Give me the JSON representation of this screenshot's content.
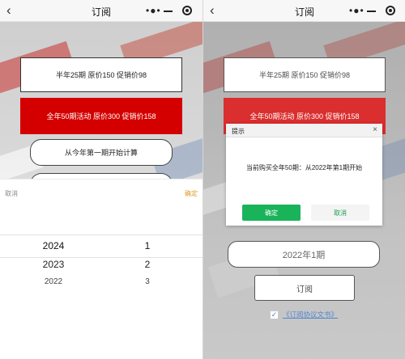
{
  "colors": {
    "accent_red": "#d40000",
    "confirm_orange": "#e59a2b",
    "ok_green": "#19b35a",
    "link_blue": "#2a6bc2"
  },
  "left_screen": {
    "navbar": {
      "back_icon": "chevron-left-icon",
      "title": "订阅",
      "more_icon": "more-dots-icon",
      "minimize_icon": "minimize-icon",
      "close_icon": "target-close-icon"
    },
    "plans": {
      "half_year": "半年25期 原价150 促销价98",
      "full_year": "全年50期活动 原价300 促销价158"
    },
    "start_button": "从今年第一期开始计算",
    "picker_sheet": {
      "cancel": "取消",
      "confirm": "确定",
      "years": [
        "2024",
        "2023",
        "2022"
      ],
      "issues": [
        "1",
        "2",
        "3"
      ]
    }
  },
  "right_screen": {
    "navbar": {
      "back_icon": "chevron-left-icon",
      "title": "订阅",
      "more_icon": "more-dots-icon",
      "minimize_icon": "minimize-icon",
      "close_icon": "target-close-icon"
    },
    "plans": {
      "half_year": "半年25期 原价150 促销价98",
      "full_year": "全年50期活动 原价300 促销价158"
    },
    "dialog": {
      "title": "提示",
      "close_glyph": "×",
      "message": "当前购买全年50期：从2022年第1期开始",
      "ok": "确定",
      "cancel": "取消"
    },
    "selected_period": "2022年1期",
    "subscribe_button": "订阅",
    "agreement": {
      "checked": true,
      "check_glyph": "✓",
      "link": "《订阅协议文书》"
    }
  }
}
